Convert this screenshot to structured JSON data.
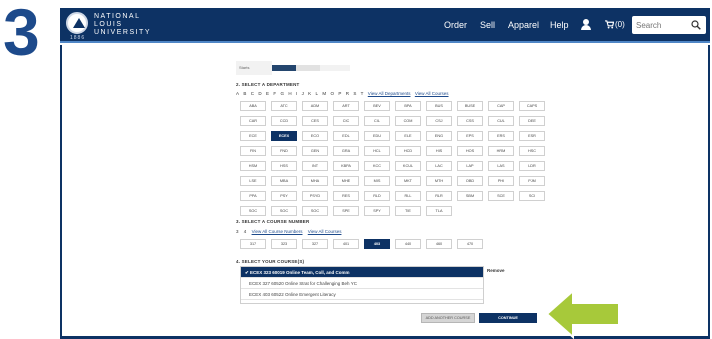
{
  "step_number": "3",
  "header": {
    "logo_lines": [
      "NATIONAL",
      "LOUIS",
      "UNIVERSITY"
    ],
    "logo_year": "1886",
    "nav": [
      "Order",
      "Sell",
      "Apparel",
      "Help"
    ],
    "cart_count": "(0)",
    "search_placeholder": "Search",
    "brand_color": "#0d3264"
  },
  "term": {
    "label": "Starts"
  },
  "department": {
    "title": "2. SELECT A DEPARTMENT",
    "letters": [
      "A",
      "B",
      "C",
      "D",
      "E",
      "F",
      "G",
      "H",
      "I",
      "J",
      "K",
      "L",
      "M",
      "O",
      "P",
      "R",
      "S",
      "T"
    ],
    "view_all_departments": "View All Departments",
    "view_all_courses": "View All Courses",
    "rows": [
      [
        "ABA",
        "ATC",
        "ADM",
        "ART",
        "BEV",
        "BPA",
        "BUS",
        "BUSE",
        "CAP",
        "CAPS"
      ],
      [
        "CAR",
        "CCD",
        "CES",
        "CIC",
        "CIL",
        "COM",
        "CSJ",
        "CSS",
        "CUL",
        "DEE"
      ],
      [
        "ECE",
        "ECEX",
        "ECO",
        "EDL",
        "EDU",
        "ELE",
        "ENG",
        "EPS",
        "ERS",
        "ESR"
      ],
      [
        "FIN",
        "FND",
        "GEN",
        "GRA",
        "HCL",
        "HCD",
        "HIS",
        "HOS",
        "HRM",
        "HSC"
      ],
      [
        "HSM",
        "HSS",
        "INT",
        "KBPA",
        "KCC",
        "KCUL",
        "LAC",
        "LAP",
        "LAS",
        "LDR"
      ],
      [
        "LSE",
        "MBA",
        "MHA",
        "MHE",
        "MIS",
        "MKT",
        "MTH",
        "OBD",
        "PHI",
        "PJM"
      ],
      [
        "PPA",
        "PSY",
        "PSYD",
        "RES",
        "RLD",
        "RLL",
        "RLR",
        "SBM",
        "SCE",
        "SCI"
      ],
      [
        "SOC",
        "SOC",
        "SOC",
        "SPE",
        "SPY",
        "TIE",
        "TLA"
      ]
    ],
    "selected": "ECEX"
  },
  "course_number": {
    "title": "3. SELECT A COURSE NUMBER",
    "digits": [
      "3",
      "4"
    ],
    "view_all_course_numbers": "View All Course Numbers",
    "view_all_courses": "View All Courses",
    "numbers": [
      "317",
      "323",
      "327",
      "401",
      "403",
      "440",
      "460",
      "470"
    ],
    "selected": "403"
  },
  "your_courses": {
    "title": "4. SELECT YOUR COURSE(S)",
    "items": [
      {
        "label": "✔ ECEX 323 60019 Online Team, Coll, and Comm",
        "selected": true
      },
      {
        "label": "ECEX 327 60520 Online Strat for Challenging Beh YC",
        "selected": false
      },
      {
        "label": "ECEX 403 60522 Online Emergent Literacy",
        "selected": false
      }
    ],
    "remove_label": "Remove"
  },
  "buttons": {
    "add_another": "ADD ANOTHER COURSE",
    "continue": "CONTINUE"
  },
  "colors": {
    "accent_green": "#a7c93a",
    "selected_blue": "#0d3264"
  }
}
